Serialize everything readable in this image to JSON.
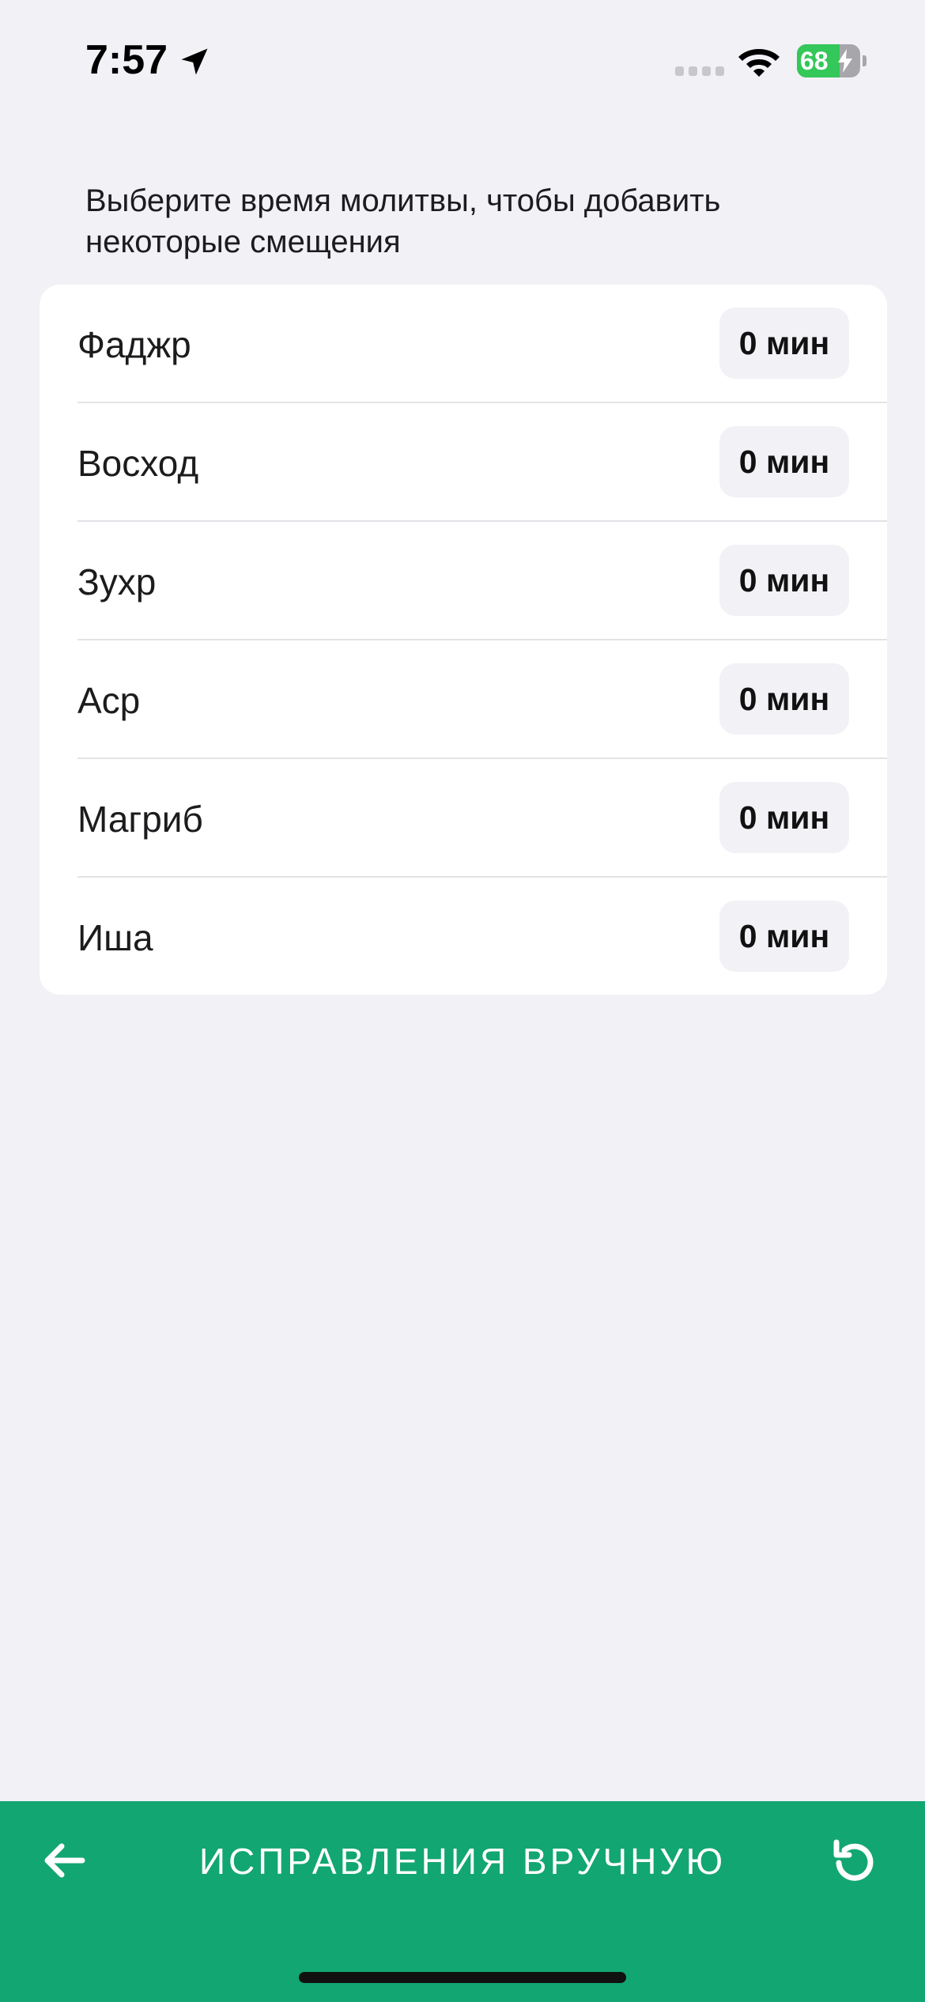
{
  "status_bar": {
    "time": "7:57",
    "battery_level": "68",
    "battery_fraction": 0.68,
    "icons": [
      "location-arrow-icon",
      "cellular-signal-icon",
      "wifi-icon",
      "battery-charging-icon"
    ]
  },
  "instruction": "Выберите время молитвы, чтобы добавить некоторые смещения",
  "offsets": [
    {
      "label": "Фаджр",
      "value": "0 мин"
    },
    {
      "label": "Восход",
      "value": "0 мин"
    },
    {
      "label": "Зухр",
      "value": "0 мин"
    },
    {
      "label": "Аср",
      "value": "0 мин"
    },
    {
      "label": "Магриб",
      "value": "0 мин"
    },
    {
      "label": "Иша",
      "value": "0 мин"
    }
  ],
  "toolbar": {
    "title": "ИСПРАВЛЕНИЯ ВРУЧНУЮ",
    "back_icon": "arrow-left-icon",
    "reset_icon": "reset-icon"
  },
  "colors": {
    "accent": "#12a672",
    "background": "#f1f1f6",
    "card": "#ffffff",
    "battery_green": "#34c759"
  }
}
